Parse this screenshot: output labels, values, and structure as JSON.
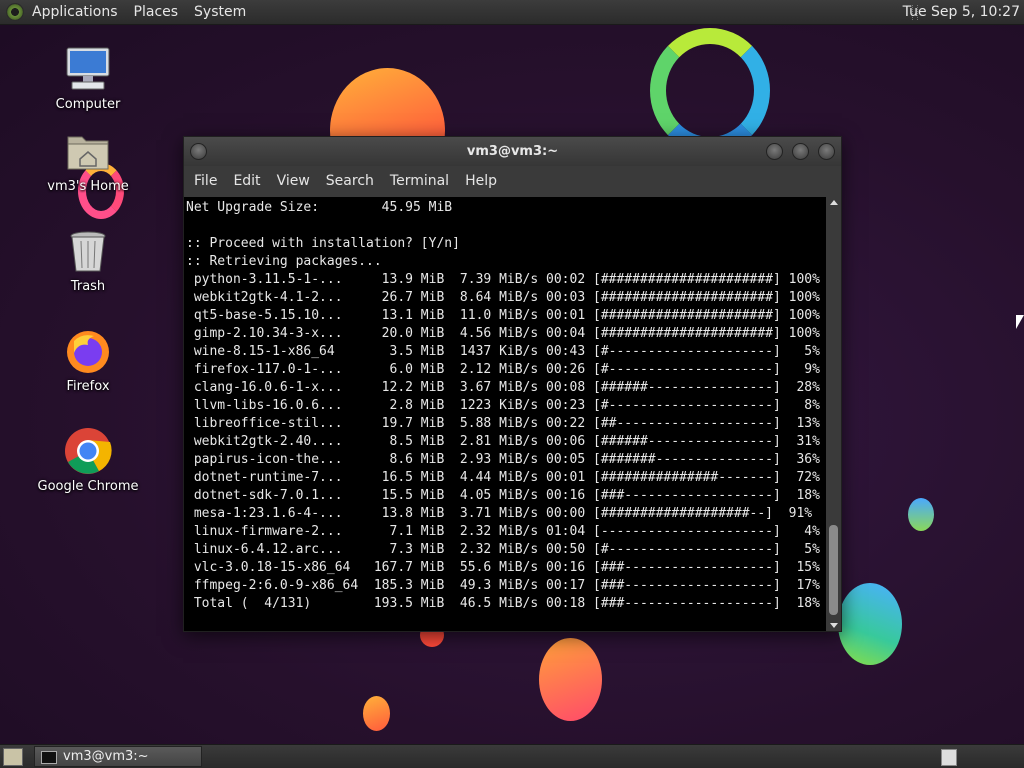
{
  "top_panel": {
    "menus": [
      "Applications",
      "Places",
      "System"
    ],
    "clock": "Tue Sep  5, 10:27"
  },
  "desktop": {
    "icons": [
      {
        "label": "Computer",
        "icon": "computer-icon"
      },
      {
        "label": "vm3's Home",
        "icon": "home-folder-icon"
      },
      {
        "label": "Trash",
        "icon": "trash-icon"
      },
      {
        "label": "Firefox",
        "icon": "firefox-icon"
      },
      {
        "label": "Google Chrome",
        "icon": "chrome-icon"
      }
    ]
  },
  "terminal": {
    "title": "vm3@vm3:~",
    "menu": [
      "File",
      "Edit",
      "View",
      "Search",
      "Terminal",
      "Help"
    ],
    "lines": [
      "Net Upgrade Size:        45.95 MiB",
      "",
      ":: Proceed with installation? [Y/n]",
      ":: Retrieving packages...",
      " python-3.11.5-1-...     13.9 MiB  7.39 MiB/s 00:02 [######################] 100%",
      " webkit2gtk-4.1-2...     26.7 MiB  8.64 MiB/s 00:03 [######################] 100%",
      " qt5-base-5.15.10...     13.1 MiB  11.0 MiB/s 00:01 [######################] 100%",
      " gimp-2.10.34-3-x...     20.0 MiB  4.56 MiB/s 00:04 [######################] 100%",
      " wine-8.15-1-x86_64       3.5 MiB  1437 KiB/s 00:43 [#---------------------]   5%",
      " firefox-117.0-1-...      6.0 MiB  2.12 MiB/s 00:26 [#---------------------]   9%",
      " clang-16.0.6-1-x...     12.2 MiB  3.67 MiB/s 00:08 [######----------------]  28%",
      " llvm-libs-16.0.6...      2.8 MiB  1223 KiB/s 00:23 [#---------------------]   8%",
      " libreoffice-stil...     19.7 MiB  5.88 MiB/s 00:22 [##--------------------]  13%",
      " webkit2gtk-2.40....      8.5 MiB  2.81 MiB/s 00:06 [######----------------]  31%",
      " papirus-icon-the...      8.6 MiB  2.93 MiB/s 00:05 [#######---------------]  36%",
      " dotnet-runtime-7...     16.5 MiB  4.44 MiB/s 00:01 [###############-------]  72%",
      " dotnet-sdk-7.0.1...     15.5 MiB  4.05 MiB/s 00:16 [###-------------------]  18%",
      " mesa-1:23.1.6-4-...     13.8 MiB  3.71 MiB/s 00:00 [###################--]  91%",
      " linux-firmware-2...      7.1 MiB  2.32 MiB/s 01:04 [----------------------]   4%",
      " linux-6.4.12.arc...      7.3 MiB  2.32 MiB/s 00:50 [#---------------------]   5%",
      " vlc-3.0.18-15-x86_64   167.7 MiB  55.6 MiB/s 00:16 [###-------------------]  15%",
      " ffmpeg-2:6.0-9-x86_64  185.3 MiB  49.3 MiB/s 00:17 [###-------------------]  17%",
      " Total (  4/131)        193.5 MiB  46.5 MiB/s 00:18 [###-------------------]  18%"
    ]
  },
  "taskbar": {
    "task_label": "vm3@vm3:~"
  }
}
